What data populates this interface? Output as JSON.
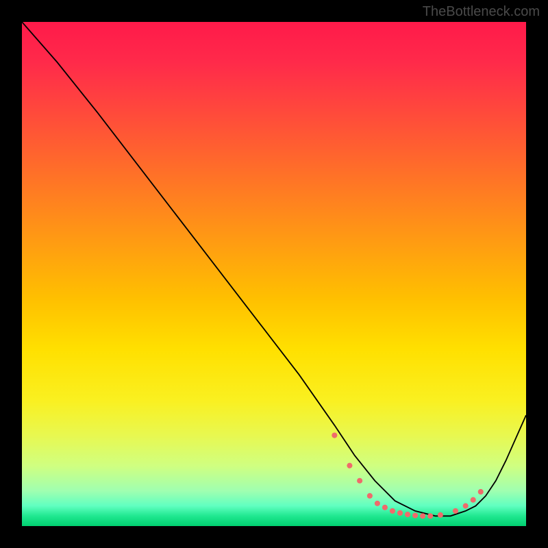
{
  "watermark": "TheBottleneck.com",
  "colors": {
    "curve": "#000000",
    "dot": "#ef6b6b",
    "background": "#000000"
  },
  "chart_data": {
    "type": "line",
    "title": "",
    "xlabel": "",
    "ylabel": "",
    "xlim": [
      0,
      100
    ],
    "ylim": [
      0,
      100
    ],
    "grid": false,
    "legend": false,
    "background_gradient": [
      "#ff1a4a",
      "#00d070"
    ],
    "series": [
      {
        "name": "bottleneck-curve",
        "x": [
          0,
          7,
          15,
          25,
          35,
          45,
          55,
          62,
          66,
          70,
          74,
          78,
          82,
          85,
          88,
          90,
          92,
          94,
          96,
          100
        ],
        "y": [
          100,
          92,
          82,
          69,
          56,
          43,
          30,
          20,
          14,
          9,
          5,
          3,
          2,
          2,
          3,
          4,
          6,
          9,
          13,
          22
        ]
      }
    ],
    "highlighted_points": {
      "name": "optimal-range-dots",
      "color": "#ef6b6b",
      "x": [
        62,
        65,
        67,
        69,
        70.5,
        72,
        73.5,
        75,
        76.5,
        78,
        79.5,
        81,
        83,
        86,
        88,
        89.5,
        91
      ],
      "y": [
        18,
        12,
        9,
        6,
        4.5,
        3.7,
        3,
        2.6,
        2.3,
        2.1,
        2,
        2,
        2.2,
        3,
        4,
        5.2,
        6.8
      ]
    }
  }
}
